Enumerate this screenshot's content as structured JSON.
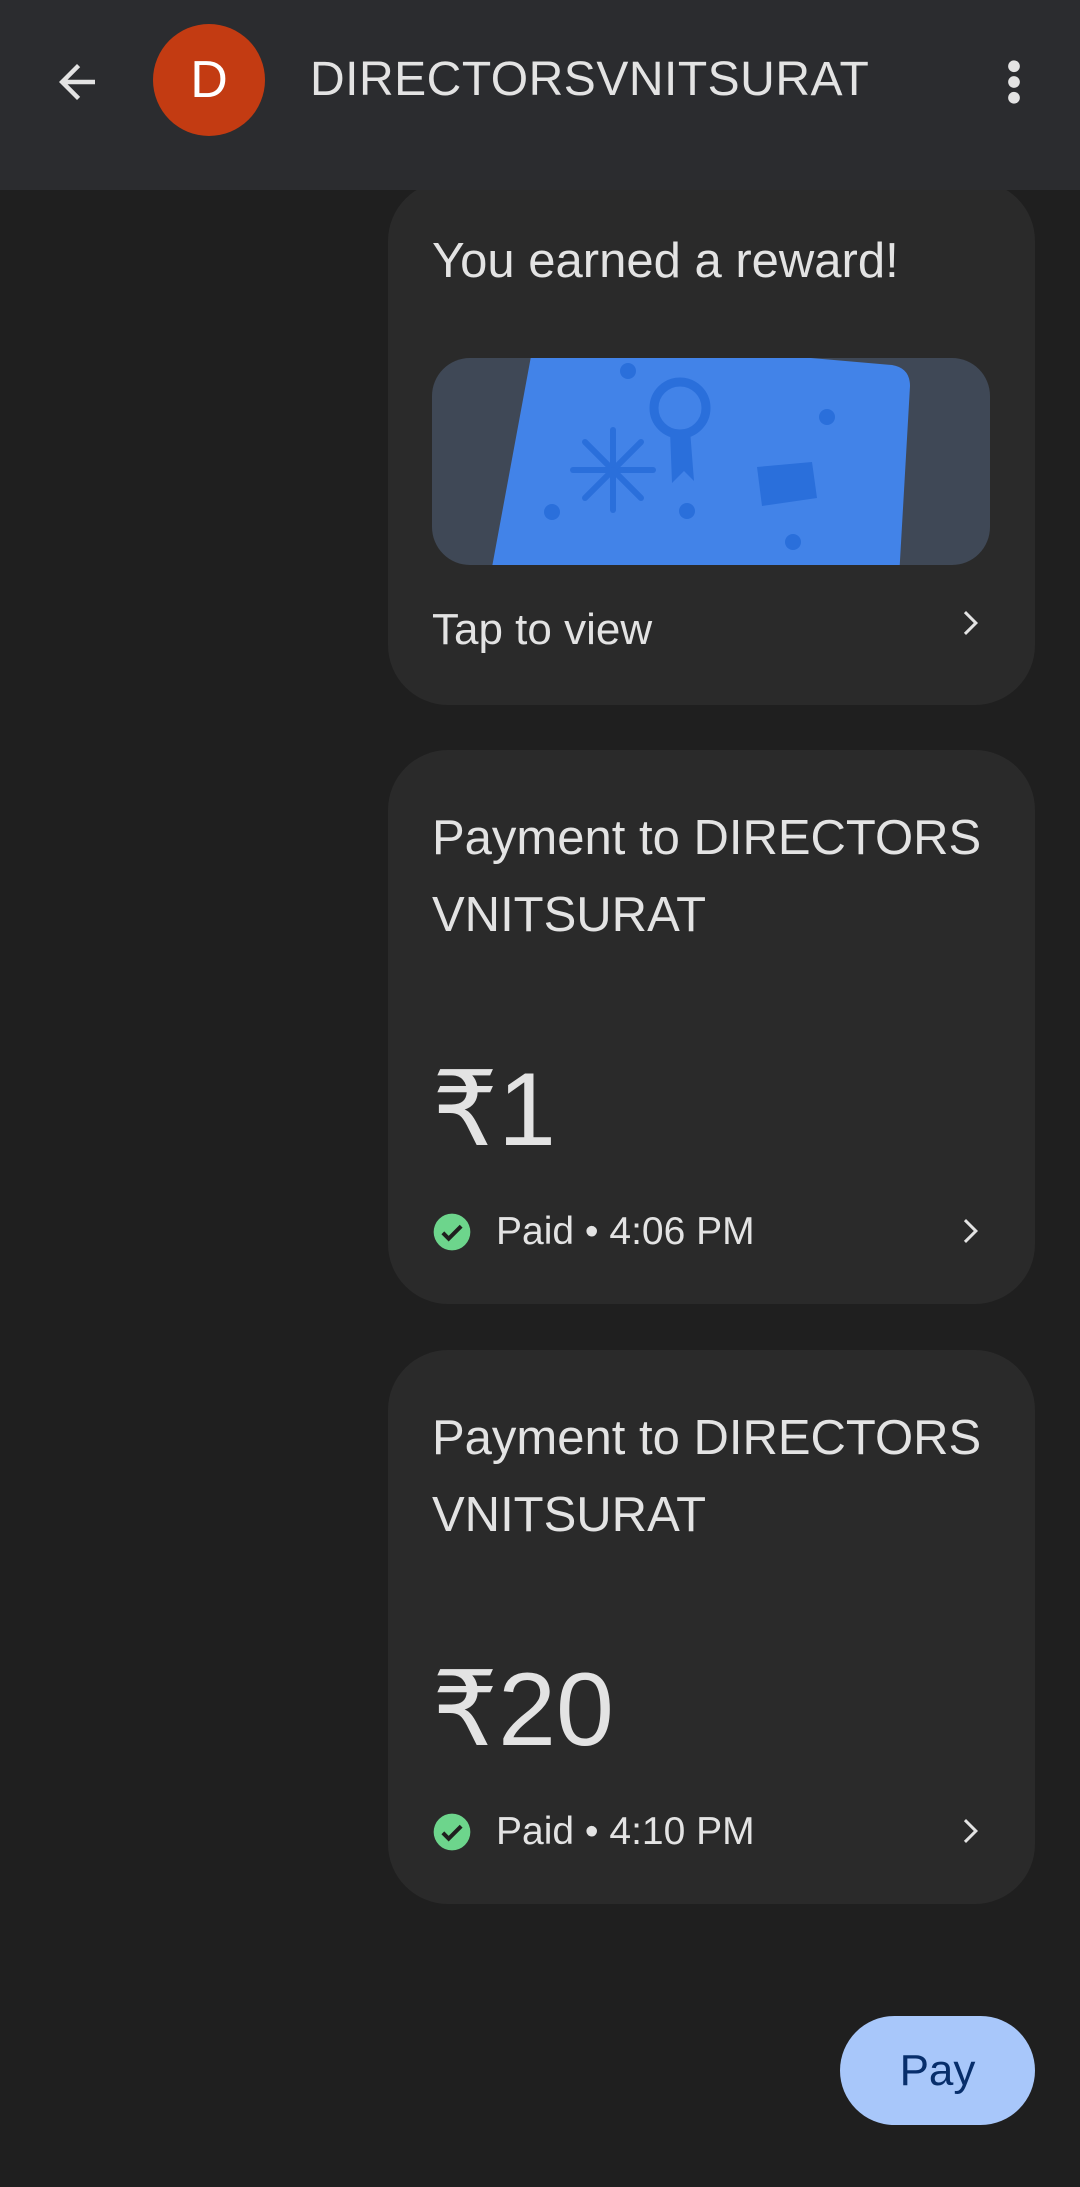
{
  "header": {
    "avatar_letter": "D",
    "title": "DIRECTORSVNITSURAT"
  },
  "reward": {
    "title": "You earned a reward!",
    "action": "Tap to view"
  },
  "payments": [
    {
      "title": "Payment to DIRECTORSVNITSURAT",
      "amount": "₹1",
      "status": "Paid • 4:06 PM"
    },
    {
      "title": "Payment to DIRECTORSVNITSURAT",
      "amount": "₹20",
      "status": "Paid • 4:10 PM"
    }
  ],
  "pay_button": "Pay",
  "colors": {
    "avatar": "#c33b12",
    "paid": "#6dd58c",
    "pay_button": "#a8c7fa",
    "reward_card": "#4283e8"
  }
}
